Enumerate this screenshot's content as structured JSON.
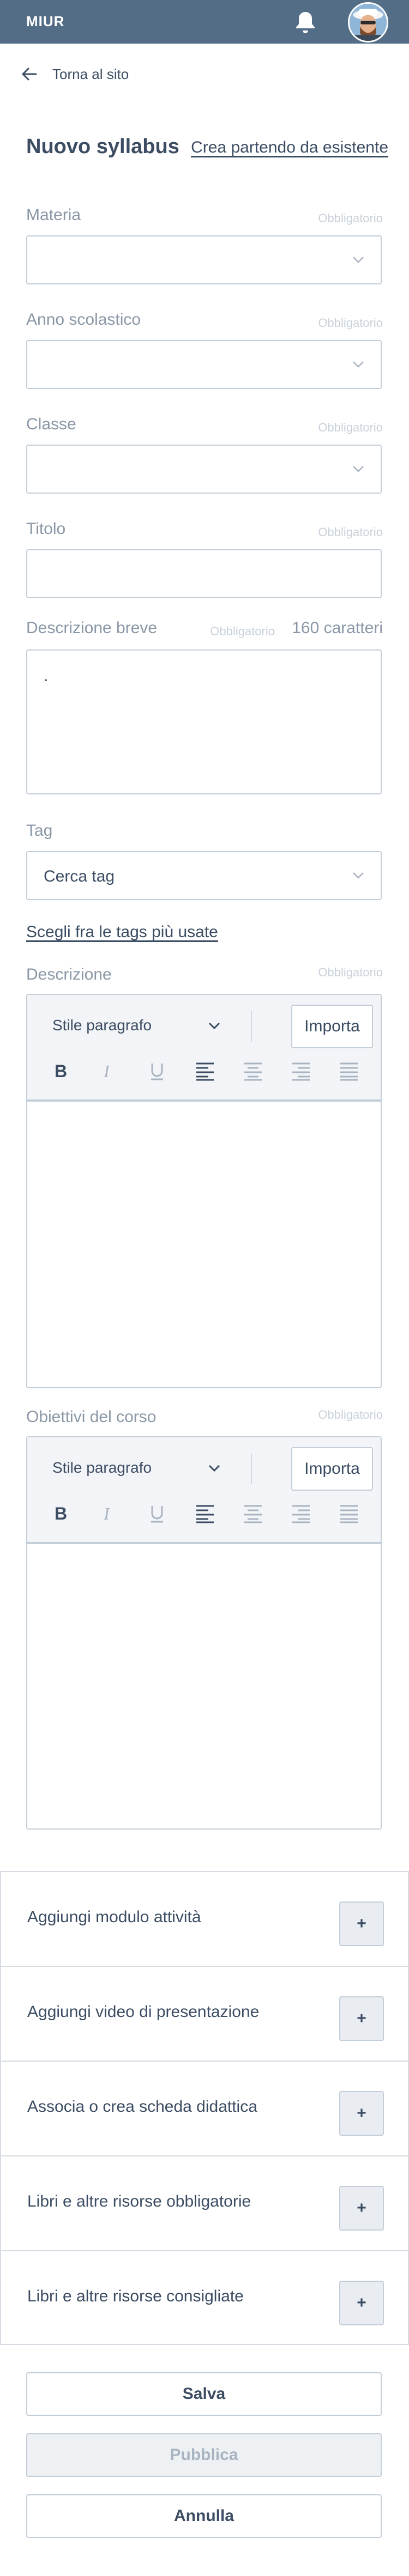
{
  "header": {
    "brand": "MIUR",
    "bell_icon": "bell-icon",
    "avatar_icon": "user-avatar"
  },
  "nav": {
    "back_label": "Torna al sito"
  },
  "page": {
    "title": "Nuovo syllabus",
    "existing_link": "Crea partendo da esistente"
  },
  "form": {
    "required_label": "Obbligatorio",
    "materia": {
      "label": "Materia",
      "value": ""
    },
    "anno": {
      "label": "Anno scolastico",
      "value": ""
    },
    "classe": {
      "label": "Classe",
      "value": ""
    },
    "titolo": {
      "label": "Titolo",
      "value": ""
    },
    "descrizione_breve": {
      "label": "Descrizione breve",
      "counter": "160 caratteri",
      "value": "."
    },
    "tag": {
      "label": "Tag",
      "placeholder": "Cerca tag",
      "suggest_link": "Scegli fra le tags più usate"
    },
    "descrizione": {
      "label": "Descrizione"
    },
    "obiettivi": {
      "label": "Obiettivi del corso"
    }
  },
  "editor": {
    "style_label": "Stile paragrafo",
    "import_label": "Importa",
    "tools": [
      "bold-icon",
      "italic-icon",
      "underline-icon",
      "align-left-icon",
      "align-center-icon",
      "align-right-icon",
      "align-justify-icon"
    ]
  },
  "sections": [
    {
      "label": "Aggiungi modulo attività",
      "button": "+"
    },
    {
      "label": "Aggiungi video di presentazione",
      "button": "+"
    },
    {
      "label": "Associa o crea scheda didattica",
      "button": "+"
    },
    {
      "label": "Libri e altre risorse obbligatorie",
      "button": "+"
    },
    {
      "label": "Libri e altre risorse consigliate",
      "button": "+"
    }
  ],
  "actions": {
    "save": "Salva",
    "publish": "Pubblica",
    "cancel": "Annulla"
  },
  "colors": {
    "header": "#536d86",
    "text": "#3c4d63",
    "muted": "#8a97a6",
    "border": "#c4ced8"
  }
}
